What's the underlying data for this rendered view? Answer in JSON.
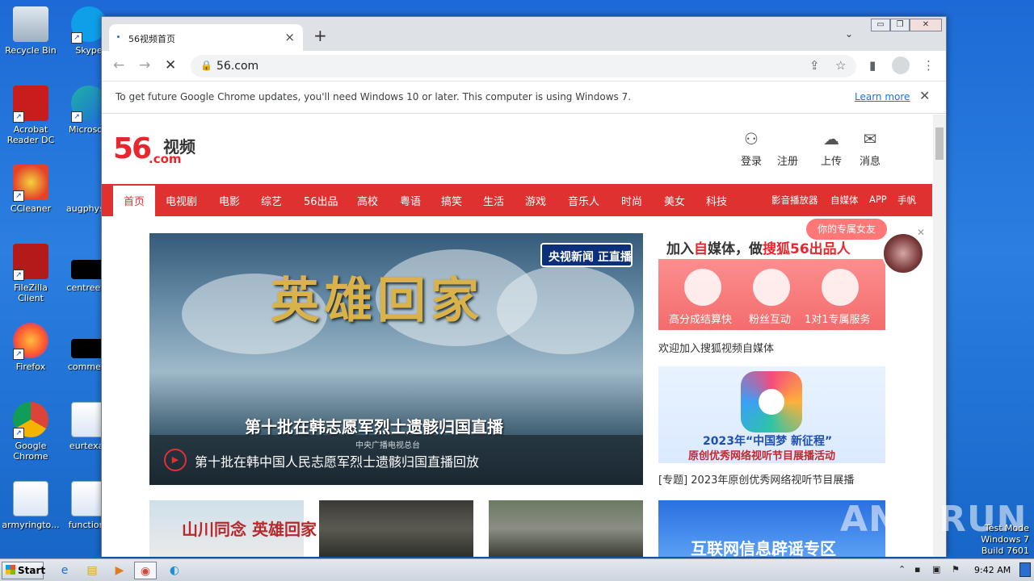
{
  "desktop": {
    "icons": [
      {
        "label": "Recycle Bin"
      },
      {
        "label": "Skype"
      },
      {
        "label": "Acrobat Reader DC"
      },
      {
        "label": "Microsoft"
      },
      {
        "label": "CCleaner"
      },
      {
        "label": "augphysic"
      },
      {
        "label": "FileZilla Client"
      },
      {
        "label": "centreeve"
      },
      {
        "label": "Firefox"
      },
      {
        "label": "comment"
      },
      {
        "label": "Google Chrome"
      },
      {
        "label": "eurtexas"
      },
      {
        "label": "armyringto..."
      },
      {
        "label": "functions"
      }
    ],
    "watermark": "ANY RUN",
    "test_mode": [
      "Test Mode",
      "Windows 7",
      "Build 7601"
    ]
  },
  "browser": {
    "tab_title": "56视频首页",
    "tab_close": "×",
    "new_tab": "+",
    "tab_dropdown": "⌄",
    "window_controls": [
      "▭",
      "❐",
      "✕"
    ],
    "url": "56.com",
    "info_message": "To get future Google Chrome updates, you'll need Windows 10 or later. This computer is using Windows 7.",
    "learn_more": "Learn more",
    "info_close": "✕"
  },
  "site": {
    "logo_number": "56",
    "logo_cn": "视频",
    "logo_com": ".com",
    "header_actions": [
      {
        "label": "登录",
        "icon": "user-icon"
      },
      {
        "label": "注册",
        "icon": ""
      },
      {
        "label": "上传",
        "icon": "upload-icon"
      },
      {
        "label": "消息",
        "icon": "message-icon"
      }
    ],
    "nav": [
      "首页",
      "电视剧",
      "电影",
      "综艺",
      "56出品",
      "高校",
      "粤语",
      "搞笑",
      "生活",
      "游戏",
      "音乐人",
      "时尚",
      "美女",
      "科技"
    ],
    "nav_right": [
      "影音播放器",
      "自媒体",
      "APP",
      "手帆"
    ],
    "hero": {
      "title": "英雄回家",
      "live_badge": "央视新闻 正直播",
      "subtitle": "第十批在韩志愿军烈士遗骸归国直播",
      "org": "中央广播电视总台",
      "caption": "第十批在韩中国人民志愿军烈士遗骸归国直播回放"
    },
    "ad1": {
      "headline_a": "加入",
      "headline_red1": "自",
      "headline_b": "媒体，做",
      "headline_red2": "搜狐56出品人",
      "features": [
        "高分成结算快",
        "粉丝互动",
        "1对1专属服务"
      ]
    },
    "companion_bubble": "你的专属女友",
    "ad1_text": "欢迎加入搜狐视频自媒体",
    "ad2": {
      "line1": "2023年“中国梦 新征程”",
      "line2": "原创优秀网络视听节目展播活动"
    },
    "ad2_text": "[专题] 2023年原创优秀网络视听节目展播",
    "thumb1_text": "山川同念 英雄回家",
    "thumb4_text": "互联网信息辟谣专区"
  },
  "taskbar": {
    "start": "Start",
    "clock": "9:42 AM"
  },
  "colors": {
    "accent": "#e03131",
    "link": "#1a73e8"
  }
}
